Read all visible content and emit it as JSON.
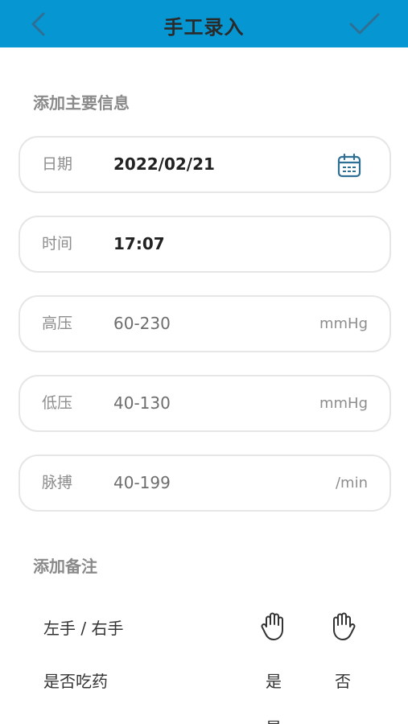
{
  "header": {
    "title": "手工录入",
    "colors": {
      "bar": "#0697d3",
      "icon": "#2f6f93"
    }
  },
  "main_section": {
    "title": "添加主要信息"
  },
  "fields": [
    {
      "label": "日期",
      "value": "2022/02/21",
      "unit": "",
      "icon": "calendar-icon"
    },
    {
      "label": "时间",
      "value": "17:07",
      "unit": ""
    },
    {
      "label": "高压",
      "value": "60-230",
      "unit": "mmHg"
    },
    {
      "label": "低压",
      "value": "40-130",
      "unit": "mmHg"
    },
    {
      "label": "脉搏",
      "value": "40-199",
      "unit": "/min"
    }
  ],
  "notes_section": {
    "title": "添加备注",
    "rows": [
      {
        "label": "左手 / 右手",
        "options": [
          "left-hand-icon",
          "right-hand-icon"
        ]
      },
      {
        "label": "是否吃药",
        "options": [
          "是",
          "否"
        ]
      },
      {
        "label": "",
        "options": [
          "是",
          ""
        ]
      }
    ]
  }
}
